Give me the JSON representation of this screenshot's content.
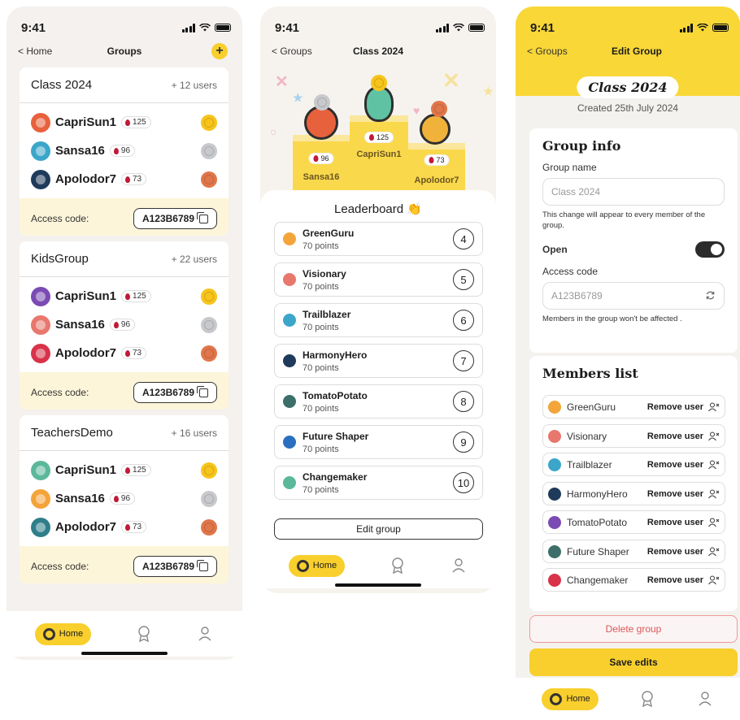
{
  "status": {
    "time": "9:41"
  },
  "colors": {
    "accent": "#f8cf2c",
    "gold": "#f7c41b",
    "silver": "#c7c9cc",
    "bronze": "#e0764a",
    "danger": "#d95a5a"
  },
  "screen1": {
    "back_label": "Home",
    "title": "Groups",
    "add_icon": "plus-icon",
    "access_label": "Access code:",
    "groups": [
      {
        "name": "Class 2024",
        "users": "+ 12 users",
        "code": "A123B6789",
        "members": [
          {
            "name": "CapriSun1",
            "points": "125",
            "medal": "gold"
          },
          {
            "name": "Sansa16",
            "points": "96",
            "medal": "silver"
          },
          {
            "name": "Apolodor7",
            "points": "73",
            "medal": "bronze"
          }
        ]
      },
      {
        "name": "KidsGroup",
        "users": "+ 22 users",
        "code": "A123B6789",
        "members": [
          {
            "name": "CapriSun1",
            "points": "125",
            "medal": "gold"
          },
          {
            "name": "Sansa16",
            "points": "96",
            "medal": "silver"
          },
          {
            "name": "Apolodor7",
            "points": "73",
            "medal": "bronze"
          }
        ]
      },
      {
        "name": "TeachersDemo",
        "users": "+ 16 users",
        "code": "A123B6789",
        "members": [
          {
            "name": "CapriSun1",
            "points": "125",
            "medal": "gold"
          },
          {
            "name": "Sansa16",
            "points": "96",
            "medal": "silver"
          },
          {
            "name": "Apolodor7",
            "points": "73",
            "medal": "bronze"
          }
        ]
      }
    ]
  },
  "screen2": {
    "back_label": "Groups",
    "title": "Class 2024",
    "podium": {
      "first": {
        "name": "CapriSun1",
        "points": "125"
      },
      "second": {
        "name": "Sansa16",
        "points": "96"
      },
      "third": {
        "name": "Apolodor7",
        "points": "73"
      }
    },
    "leaderboard_title": "Leaderboard",
    "leaderboard_emoji": "👏",
    "leaderboard": [
      {
        "name": "GreenGuru",
        "points": "70 points",
        "rank": "4"
      },
      {
        "name": "Visionary",
        "points": "70 points",
        "rank": "5"
      },
      {
        "name": "Trailblazer",
        "points": "70 points",
        "rank": "6"
      },
      {
        "name": "HarmonyHero",
        "points": "70 points",
        "rank": "7"
      },
      {
        "name": "TomatoPotato",
        "points": "70 points",
        "rank": "8"
      },
      {
        "name": "Future Shaper",
        "points": "70 points",
        "rank": "9"
      },
      {
        "name": "Changemaker",
        "points": "70 points",
        "rank": "10"
      }
    ],
    "edit_button": "Edit group"
  },
  "screen3": {
    "back_label": "Groups",
    "title": "Edit Group",
    "class_name": "Class 2024",
    "created": "Created 25th July 2024",
    "group_info": {
      "title": "Group info",
      "name_label": "Group name",
      "name_placeholder": "Class 2024",
      "name_note": "This change will appear to every member of the group.",
      "open_label": "Open",
      "open_state": true,
      "code_label": "Access code",
      "code_value": "A123B6789",
      "code_note": "Members in the group won't be affected ."
    },
    "members_title": "Members list",
    "remove_label": "Remove user",
    "members": [
      "GreenGuru",
      "Visionary",
      "Trailblazer",
      "HarmonyHero",
      "TomatoPotato",
      "Future Shaper",
      "Changemaker"
    ],
    "delete_button": "Delete group",
    "save_button": "Save edits"
  },
  "tabbar": {
    "home_label": "Home",
    "icons": [
      "home-icon",
      "award-icon",
      "profile-icon"
    ]
  }
}
